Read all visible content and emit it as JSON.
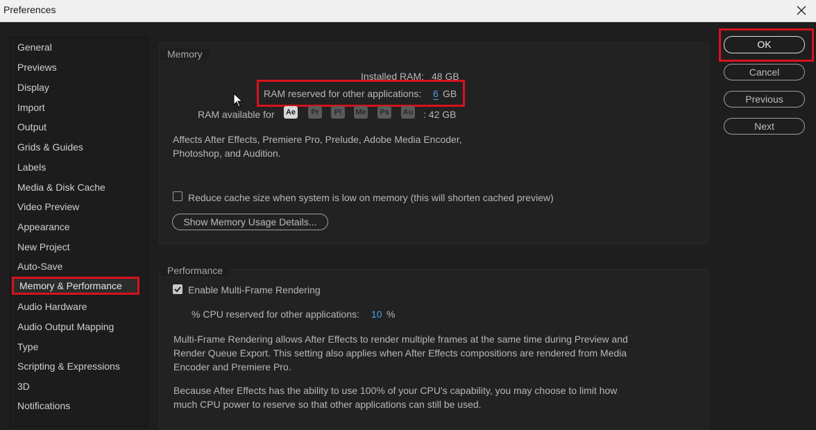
{
  "window": {
    "title": "Preferences"
  },
  "sidebar": {
    "items": [
      {
        "label": "General"
      },
      {
        "label": "Previews"
      },
      {
        "label": "Display"
      },
      {
        "label": "Import"
      },
      {
        "label": "Output"
      },
      {
        "label": "Grids & Guides"
      },
      {
        "label": "Labels"
      },
      {
        "label": "Media & Disk Cache"
      },
      {
        "label": "Video Preview"
      },
      {
        "label": "Appearance"
      },
      {
        "label": "New Project"
      },
      {
        "label": "Auto-Save"
      },
      {
        "label": "Memory & Performance"
      },
      {
        "label": "Audio Hardware"
      },
      {
        "label": "Audio Output Mapping"
      },
      {
        "label": "Type"
      },
      {
        "label": "Scripting & Expressions"
      },
      {
        "label": "3D"
      },
      {
        "label": "Notifications"
      }
    ],
    "selected": "Memory & Performance"
  },
  "memory": {
    "section_title": "Memory",
    "installed_label": "Installed RAM:",
    "installed_value": "48 GB",
    "reserved_label": "RAM reserved for other applications:",
    "reserved_value": "6",
    "reserved_unit": "GB",
    "available_label": "RAM available for",
    "apps": [
      "Ae",
      "Pr",
      "Pl",
      "Me",
      "Ps",
      "Au"
    ],
    "available_value": ": 42 GB",
    "affects_line1": "Affects After Effects, Premiere Pro, Prelude, Adobe Media Encoder,",
    "affects_line2": "Photoshop, and Audition.",
    "reduce_cache_label": "Reduce cache size when system is low on memory (this will shorten cached preview)",
    "show_usage_label": "Show Memory Usage Details..."
  },
  "performance": {
    "section_title": "Performance",
    "mfr_label": "Enable Multi-Frame Rendering",
    "cpu_label": "% CPU reserved for other applications:",
    "cpu_value": "10",
    "cpu_unit": "%",
    "desc1_line1": "Multi-Frame Rendering allows After Effects to render multiple frames at the same time during Preview and",
    "desc1_line2": "Render Queue Export. This setting also applies when After Effects compositions are rendered from Media",
    "desc1_line3": "Encoder and Premiere Pro.",
    "desc2_line1": "Because After Effects has the ability to use 100% of your CPU's capability, you may choose to limit how",
    "desc2_line2": "much CPU power to reserve so that other applications can still be used."
  },
  "buttons": {
    "ok": "OK",
    "cancel": "Cancel",
    "previous": "Previous",
    "next": "Next"
  },
  "colors": {
    "highlight": "#d8131c",
    "accent": "#4a9fe8",
    "background": "#1e1e1e"
  }
}
